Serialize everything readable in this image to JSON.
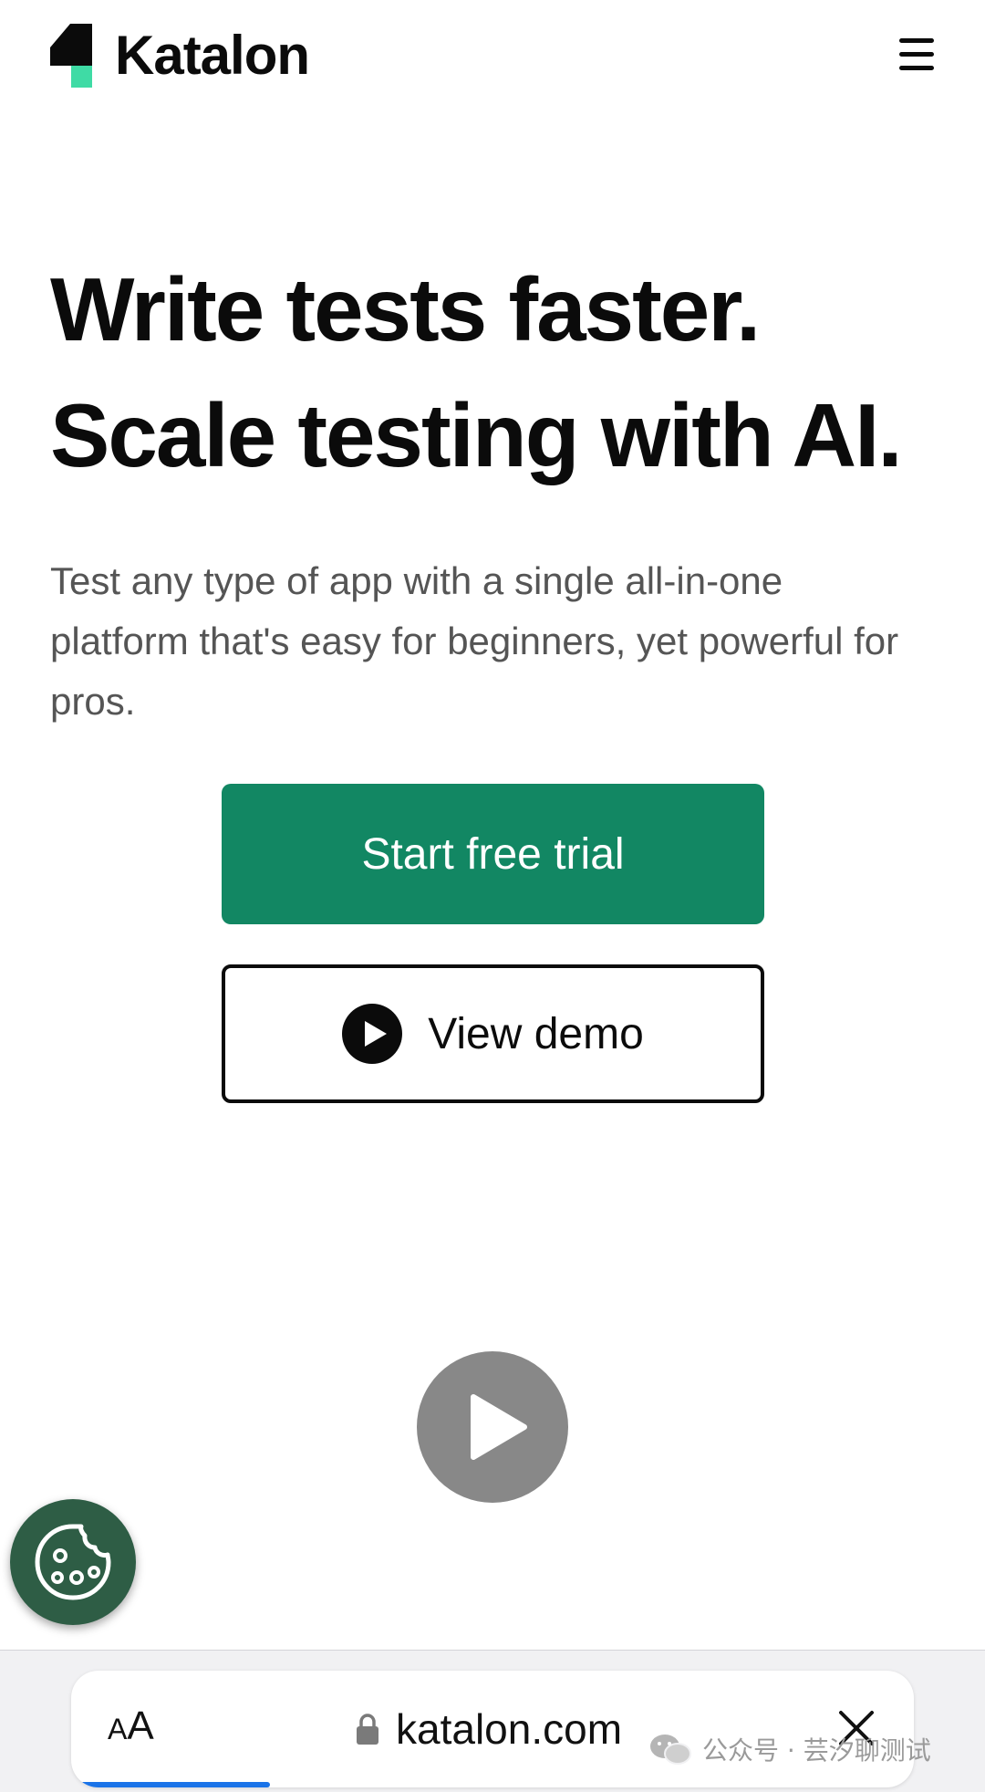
{
  "header": {
    "logo_text": "Katalon",
    "brand_colors": {
      "mark_dark": "#0b0b0b",
      "mark_accent": "#3fdba5"
    },
    "menu_icon": "hamburger-menu-icon"
  },
  "hero": {
    "title_line1": "Write tests faster.",
    "title_line2": "Scale testing with AI.",
    "subtitle": "Test any type of app with a single all-in-one platform that's easy for beginners, yet powerful for pros.",
    "primary_button": "Start free trial",
    "secondary_button": "View demo",
    "primary_color": "#128763"
  },
  "media": {
    "play_icon": "play-icon"
  },
  "cookie": {
    "icon": "cookie-icon",
    "color": "#2e5d45"
  },
  "browser": {
    "text_size_label_small": "A",
    "text_size_label_big": "A",
    "url": "katalon.com",
    "lock_icon": "lock-icon",
    "close_icon": "close-icon",
    "load_progress": 0.23
  },
  "watermark": {
    "text": "公众号 · 芸汐聊测试"
  }
}
